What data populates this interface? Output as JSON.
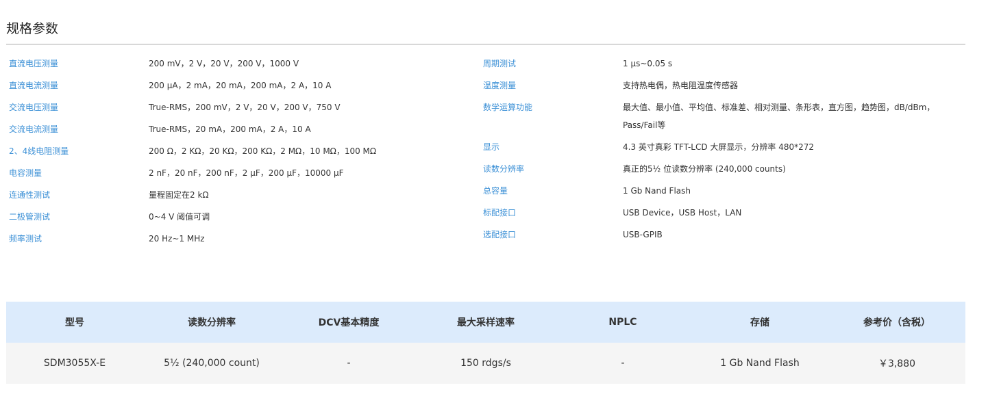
{
  "section": {
    "title": "规格参数"
  },
  "specs_left": [
    {
      "label": "直流电压测量",
      "value": "200 mV，2 V，20 V，200 V，1000 V"
    },
    {
      "label": "直流电流测量",
      "value": "200 μA，2 mA，20 mA，200 mA，2 A，10 A"
    },
    {
      "label": "交流电压测量",
      "value": "True-RMS，200 mV，2 V，20 V，200 V，750 V"
    },
    {
      "label": "交流电流测量",
      "value": "True-RMS，20 mA，200 mA，2 A，10 A"
    },
    {
      "label": "2、4线电阻测量",
      "value": "200 Ω，2 KΩ，20 KΩ，200 KΩ，2 MΩ，10 MΩ，100 MΩ"
    },
    {
      "label": "电容测量",
      "value": "2 nF，20 nF，200 nF，2 μF，200 μF，10000 μF"
    },
    {
      "label": "连通性测试",
      "value": "量程固定在2 kΩ"
    },
    {
      "label": "二极管测试",
      "value": "0~4 V 阈值可调"
    },
    {
      "label": "频率测试",
      "value": "20 Hz~1 MHz"
    }
  ],
  "specs_right": [
    {
      "label": "周期测试",
      "value": "1 μs~0.05 s"
    },
    {
      "label": "温度测量",
      "value": "支持热电偶，热电阻温度传感器"
    },
    {
      "label": "数学运算功能",
      "value": "最大值、最小值、平均值、标准差、相对测量、条形表，直方图，趋势图，dB/dBm，Pass/Fail等"
    },
    {
      "label": "显示",
      "value": "4.3 英寸真彩 TFT-LCD 大屏显示，分辨率 480*272"
    },
    {
      "label": "读数分辨率",
      "value": "真正的5½ 位读数分辨率 (240,000 counts)"
    },
    {
      "label": "总容量",
      "value": "1 Gb Nand Flash"
    },
    {
      "label": "标配接口",
      "value": "USB Device，USB Host，LAN"
    },
    {
      "label": "选配接口",
      "value": "USB-GPIB"
    }
  ],
  "model_table": {
    "headers": [
      "型号",
      "读数分辨率",
      "DCV基本精度",
      "最大采样速率",
      "NPLC",
      "存储",
      "参考价（含税）"
    ],
    "rows": [
      [
        "SDM3055X-E",
        "5½ (240,000 count)",
        "-",
        "150 rdgs/s",
        "-",
        "1 Gb Nand Flash",
        "￥3,880"
      ]
    ]
  },
  "colors": {
    "label_blue": "#3a8fd6",
    "table_header_bg": "#dcebfc",
    "table_row_bg": "#f5f5f5"
  }
}
